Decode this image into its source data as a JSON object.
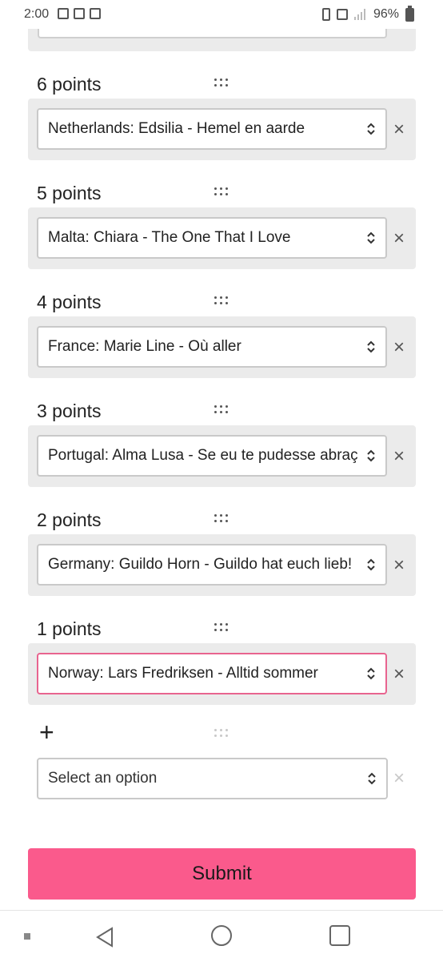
{
  "status_bar": {
    "time": "2:00",
    "battery_percent": "96%",
    "icons": [
      "image-icon",
      "mail-icon",
      "battery-saver-icon",
      "vibrate-icon",
      "lte-icon",
      "signal-icon",
      "battery-icon"
    ]
  },
  "rankings": [
    {
      "label": "6 points",
      "selected": "Netherlands: Edsilia - Hemel en aarde"
    },
    {
      "label": "5 points",
      "selected": "Malta: Chiara - The One That I Love"
    },
    {
      "label": "4 points",
      "selected": "France: Marie Line - Où aller"
    },
    {
      "label": "3 points",
      "selected": "Portugal: Alma Lusa - Se eu te pudesse abraçar"
    },
    {
      "label": "2 points",
      "selected": "Germany: Guildo Horn - Guildo hat euch lieb!"
    },
    {
      "label": "1 points",
      "selected": "Norway: Lars Fredriksen - Alltid sommer"
    }
  ],
  "add_row": {
    "plus_symbol": "+",
    "placeholder": "Select an option"
  },
  "remove_symbol": "×",
  "submit_label": "Submit",
  "colors": {
    "accent": "#fa5a8c",
    "active_border": "#e8648f",
    "panel_bg": "#ebebeb"
  }
}
